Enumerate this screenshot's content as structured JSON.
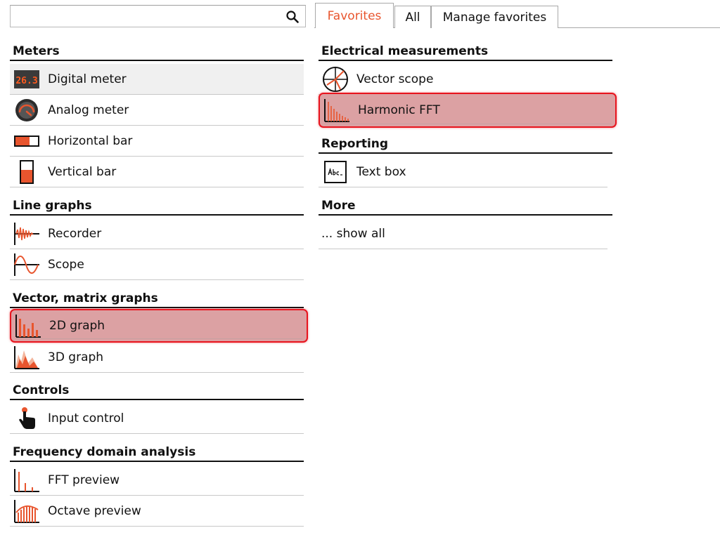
{
  "search": {
    "value": "",
    "placeholder": ""
  },
  "tabs": [
    {
      "label": "Favorites",
      "active": true
    },
    {
      "label": "All",
      "active": false
    },
    {
      "label": "Manage favorites",
      "active": false
    }
  ],
  "left": {
    "meters": {
      "title": "Meters",
      "items": [
        "Digital meter",
        "Analog meter",
        "Horizontal bar",
        "Vertical bar"
      ]
    },
    "line_graphs": {
      "title": "Line graphs",
      "items": [
        "Recorder",
        "Scope"
      ]
    },
    "vector": {
      "title": "Vector, matrix graphs",
      "items": [
        "2D graph",
        "3D graph"
      ]
    },
    "controls": {
      "title": "Controls",
      "items": [
        "Input control"
      ]
    },
    "freq": {
      "title": "Frequency domain analysis",
      "items": [
        "FFT preview",
        "Octave preview"
      ]
    }
  },
  "right": {
    "electrical": {
      "title": "Electrical measurements",
      "items": [
        "Vector scope",
        "Harmonic FFT"
      ]
    },
    "reporting": {
      "title": "Reporting",
      "items": [
        "Text box"
      ]
    },
    "more": {
      "title": "More",
      "items": [
        "... show all"
      ]
    }
  },
  "colors": {
    "accent": "#e8552e",
    "highlight_fill": "#dca1a3",
    "highlight_border": "#e8141e"
  },
  "icons": {
    "digital_meter": "digital-meter-icon",
    "digital_meter_text": "26.3"
  }
}
